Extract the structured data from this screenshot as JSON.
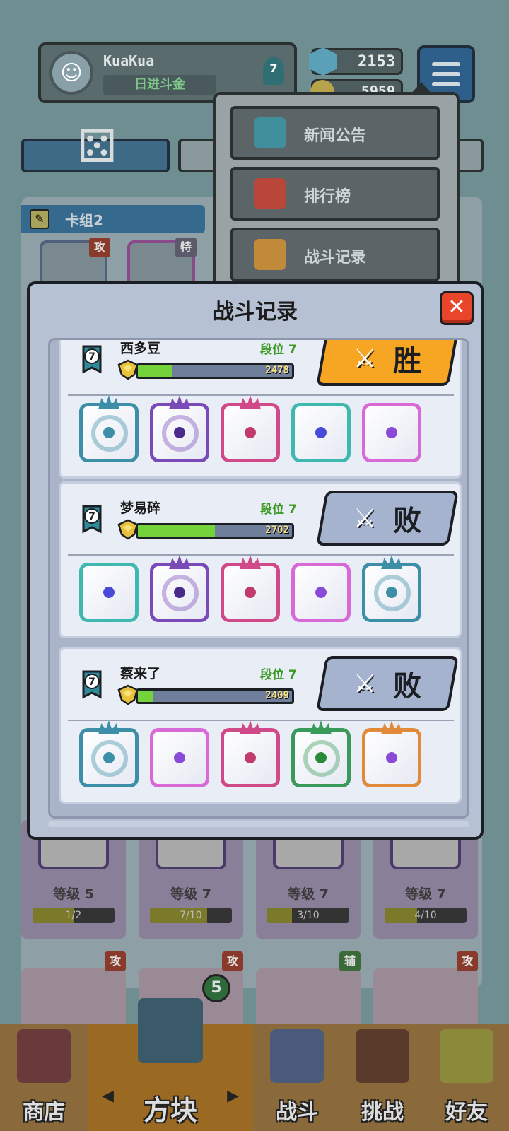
{
  "player": {
    "name": "KuaKua",
    "title": "日进斗金",
    "rank": "7"
  },
  "currency": {
    "gems": "2153",
    "coins": "5959"
  },
  "deck": {
    "name": "卡组2",
    "tags": [
      "攻",
      "特"
    ]
  },
  "menu": {
    "items": [
      {
        "label": "新闻公告",
        "icon": "news-icon",
        "color": "#3f8f9c"
      },
      {
        "label": "排行榜",
        "icon": "leaderboard-icon",
        "color": "#b8473a"
      },
      {
        "label": "战斗记录",
        "icon": "battle-record-icon",
        "color": "#c08a3a"
      }
    ]
  },
  "modal": {
    "title": "战斗记录",
    "close": "✕",
    "records": [
      {
        "name": "西多豆",
        "rank_label": "段位 7",
        "rank": "7",
        "score": "2478",
        "progress": 0.22,
        "result": "胜",
        "result_type": "win",
        "swords": "⚔",
        "dice": [
          {
            "name": "vortex-die",
            "border": "#3d8fa8",
            "pip": "#3d8fa8",
            "crown": "#3d8fa8",
            "swirl": true
          },
          {
            "name": "purple-die",
            "border": "#7a4ab8",
            "pip": "#4a2a8a",
            "crown": "#7a4ab8",
            "swirl": true
          },
          {
            "name": "pink-die",
            "border": "#d04a8a",
            "pip": "#c03a6a",
            "crown": "#d04a8a",
            "swirl": false
          },
          {
            "name": "healing-die",
            "border": "#3fb8b0",
            "pip": "#4a4ad8",
            "crown": "",
            "swirl": false
          },
          {
            "name": "rainbow-die",
            "border": "#d86ad8",
            "pip": "#8a4ad8",
            "crown": "",
            "swirl": false
          }
        ]
      },
      {
        "name": "梦易碎",
        "rank_label": "段位 7",
        "rank": "7",
        "score": "2702",
        "progress": 0.5,
        "result": "败",
        "result_type": "lose",
        "swords": "⚔",
        "dice": [
          {
            "name": "healing-die",
            "border": "#3fb8b0",
            "pip": "#4a4ad8",
            "crown": "",
            "swirl": false
          },
          {
            "name": "purple-die",
            "border": "#7a4ab8",
            "pip": "#4a2a8a",
            "crown": "#7a4ab8",
            "swirl": true
          },
          {
            "name": "pink-die",
            "border": "#d04a8a",
            "pip": "#c03a6a",
            "crown": "#d04a8a",
            "swirl": false
          },
          {
            "name": "rainbow-die",
            "border": "#d86ad8",
            "pip": "#8a4ad8",
            "crown": "",
            "swirl": false
          },
          {
            "name": "vortex-die",
            "border": "#3d8fa8",
            "pip": "#3d8fa8",
            "crown": "#3d8fa8",
            "swirl": true
          }
        ]
      },
      {
        "name": "蔡来了",
        "rank_label": "段位 7",
        "rank": "7",
        "score": "2409",
        "progress": 0.1,
        "result": "败",
        "result_type": "lose",
        "swords": "⚔",
        "dice": [
          {
            "name": "vortex-die",
            "border": "#3d8fa8",
            "pip": "#3d8fa8",
            "crown": "#3d8fa8",
            "swirl": true
          },
          {
            "name": "rainbow-die",
            "border": "#d86ad8",
            "pip": "#8a4ad8",
            "crown": "",
            "swirl": false
          },
          {
            "name": "pink-die",
            "border": "#d04a8a",
            "pip": "#c03a6a",
            "crown": "#d04a8a",
            "swirl": false
          },
          {
            "name": "green-die",
            "border": "#3a9a5a",
            "pip": "#2a8a3a",
            "crown": "#3a9a5a",
            "swirl": true
          },
          {
            "name": "infinity-die",
            "border": "#e08a3a",
            "pip": "#8a4ad8",
            "crown": "#e08a3a",
            "swirl": false
          }
        ]
      }
    ]
  },
  "bg_cards": [
    {
      "level": "等级 5",
      "progress": "1/2",
      "fill": 0.5,
      "border": "#4a3a6a"
    },
    {
      "level": "等级 7",
      "progress": "7/10",
      "fill": 0.7,
      "border": "#6a3a6a"
    },
    {
      "level": "等级 7",
      "progress": "3/10",
      "fill": 0.3,
      "border": "#8a5a2a"
    },
    {
      "level": "等级 7",
      "progress": "4/10",
      "fill": 0.4,
      "border": "#5a3a8a"
    }
  ],
  "lower_tags": [
    "攻",
    "攻",
    "辅",
    "攻"
  ],
  "dice_count": "5",
  "nav": {
    "items": [
      {
        "label": "商店",
        "icon": "shop-icon"
      },
      {
        "label": "方块",
        "icon": "cube-icon"
      },
      {
        "label": "战斗",
        "icon": "battle-icon"
      },
      {
        "label": "挑战",
        "icon": "challenge-icon"
      },
      {
        "label": "好友",
        "icon": "friends-icon"
      }
    ],
    "prev": "◀",
    "next": "▶"
  }
}
